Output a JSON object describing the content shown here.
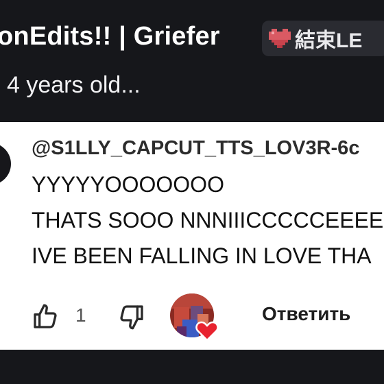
{
  "header": {
    "title": "onEdits!! | Griefer",
    "server_tag": {
      "icon": "pixel-heart-icon",
      "text": "結束LE"
    },
    "age_text": "4 years old..."
  },
  "comment": {
    "username": "@S1LLY_CAPCUT_TTS_LOV3R-6c",
    "lines": [
      "YYYYYOOOOOOO",
      "THATS SOOO NNNIIICCCCCEEEE",
      "IVE BEEN FALLING IN LOVE THA"
    ],
    "likes": "1",
    "reply_label": "Ответить"
  },
  "colors": {
    "dark_bg": "#16171b",
    "card_bg": "#ffffff",
    "tag_bg": "#2a2b31",
    "heart": "#e8232f"
  }
}
